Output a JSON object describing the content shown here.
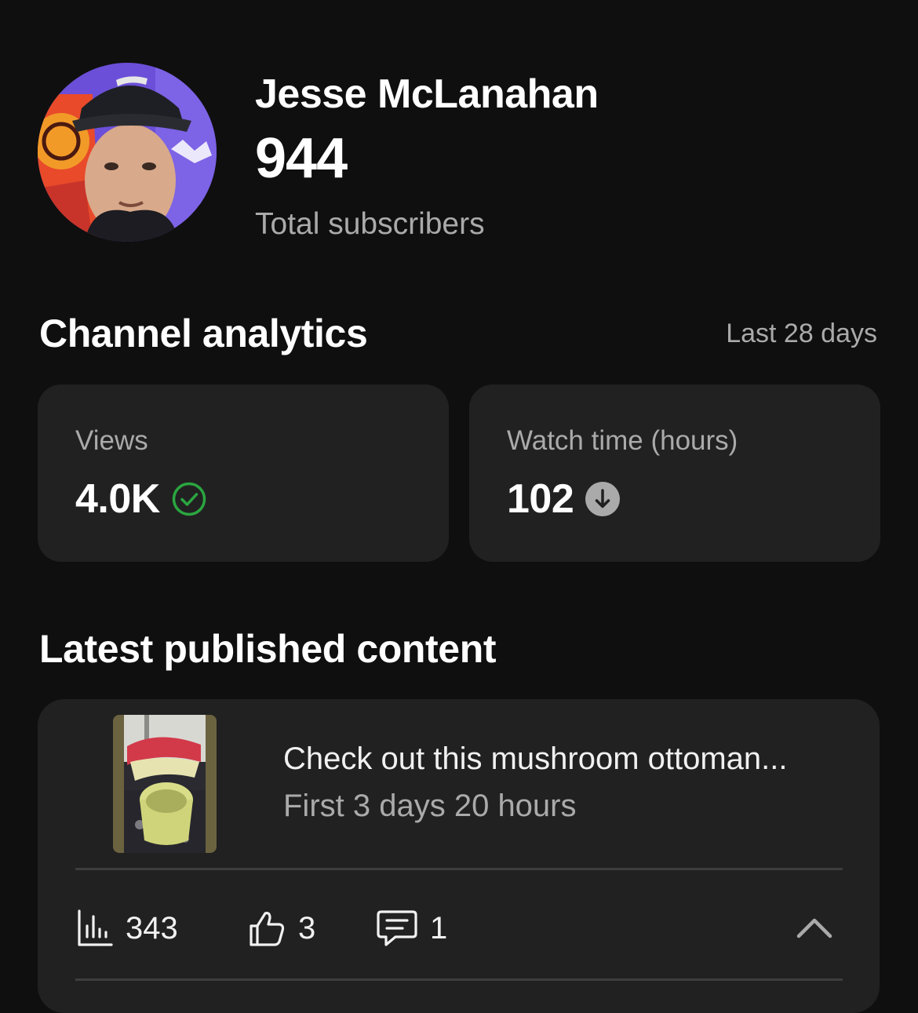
{
  "profile": {
    "channel_name": "Jesse McLanahan",
    "subscriber_count": "944",
    "subscriber_label": "Total subscribers"
  },
  "analytics": {
    "title": "Channel analytics",
    "period": "Last 28 days",
    "cards": [
      {
        "label": "Views",
        "value": "4.0K",
        "status_icon": "check-circle-icon",
        "status_color": "#2ba640"
      },
      {
        "label": "Watch time (hours)",
        "value": "102",
        "status_icon": "arrow-down-circle-icon",
        "status_color": "#aaaaaa"
      }
    ]
  },
  "latest": {
    "title": "Latest published content",
    "video": {
      "title": "Check out this mushroom ottoman...",
      "subtitle": "First 3 days 20 hours",
      "views": "343",
      "likes": "3",
      "comments": "1"
    }
  },
  "colors": {
    "background": "#0f0f0f",
    "card": "#212121",
    "text_primary": "#ffffff",
    "text_secondary": "#aaaaaa",
    "positive": "#2ba640"
  }
}
